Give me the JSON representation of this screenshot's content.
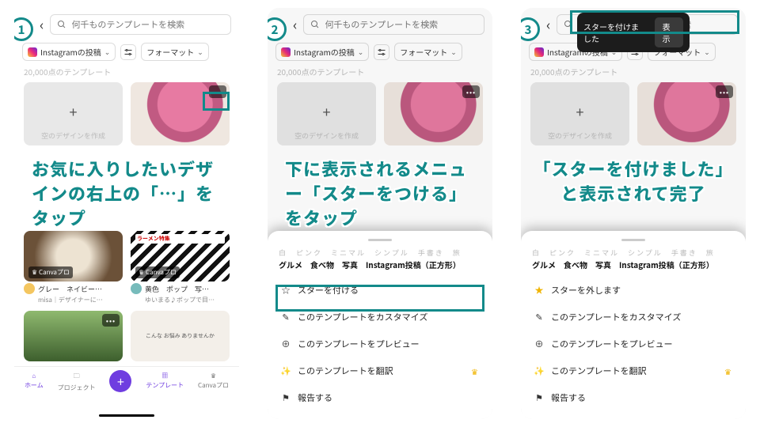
{
  "search": {
    "placeholder": "何千ものテンプレートを検索"
  },
  "chips": {
    "instagram": "Instagramの投稿",
    "format": "フォーマット"
  },
  "count": "20,000点のテンプレート",
  "empty_card": "空のデザインを作成",
  "canva_pro": "Canvaプロ",
  "gallery": {
    "t1": "グレー　ネイビー…",
    "s1": "misa｜デザイナーに…",
    "t2": "黄色　ポップ　写…",
    "s2": "ゆいまる♪ポップで目…",
    "ramen": "ラーメン特集",
    "onayami": "こんな お悩み ありませんか"
  },
  "tabs": {
    "home": "ホーム",
    "project": "プロジェクト",
    "template": "テンプレート",
    "pro": "Canvaプロ"
  },
  "sheet": {
    "tags_line": "白　ピンク　ミニマル　シンプル　手書き　旅",
    "title": "グルメ　食べ物　写真　Instagram投稿（正方形）",
    "star_add": "スターを付ける",
    "star_remove": "スターを外します",
    "customize": "このテンプレートをカスタマイズ",
    "preview": "このテンプレートをプレビュー",
    "translate": "このテンプレートを翻訳",
    "report": "報告する"
  },
  "toast": {
    "msg": "スターを付けました",
    "btn": "表示"
  },
  "annot": {
    "s1": "お気に入りしたいデザインの右上の「…」をタップ",
    "s2": "下に表示されるメニュー「スターをつける」をタップ",
    "s3": "「スターを付けました」と表示されて完了"
  },
  "step": {
    "n1": "1",
    "n2": "2",
    "n3": "3"
  }
}
